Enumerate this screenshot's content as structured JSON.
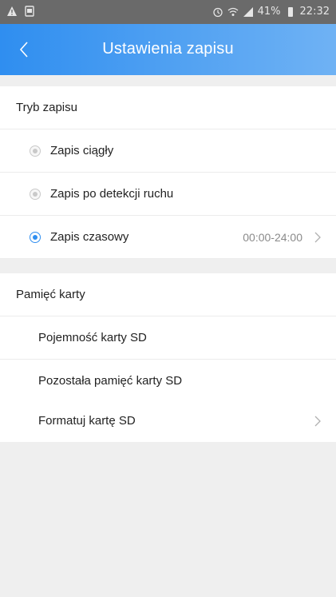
{
  "status_bar": {
    "battery": "41%",
    "time": "22:32",
    "icons": [
      "warning-icon",
      "image-icon",
      "alarm-icon",
      "wifi-icon",
      "signal-icon",
      "battery-icon"
    ]
  },
  "header": {
    "title": "Ustawienia zapisu",
    "back_icon": "chevron-left-icon"
  },
  "recording_mode": {
    "title": "Tryb zapisu",
    "options": [
      {
        "label": "Zapis ciągły",
        "selected": false
      },
      {
        "label": "Zapis po detekcji ruchu",
        "selected": false
      },
      {
        "label": "Zapis czasowy",
        "selected": true,
        "value": "00:00-24:00"
      }
    ]
  },
  "card_memory": {
    "title": "Pamięć karty",
    "items": [
      {
        "label": "Pojemność karty SD"
      },
      {
        "label": "Pozostała pamięć karty SD"
      },
      {
        "label": "Formatuj kartę SD"
      }
    ]
  },
  "colors": {
    "header_start": "#2f8ef0",
    "header_end": "#6fb2f4",
    "accent": "#2f8ef0",
    "background": "#efefef"
  }
}
